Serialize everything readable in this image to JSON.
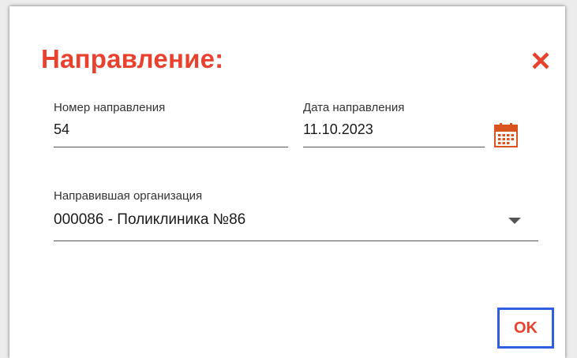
{
  "dialog": {
    "title": "Направление:",
    "close_icon": "close-x-icon",
    "ok_label": "OK"
  },
  "fields": {
    "referral_number": {
      "label": "Номер направления",
      "value": "54"
    },
    "referral_date": {
      "label": "Дата направления",
      "value": "11.10.2023",
      "icon": "calendar-icon"
    },
    "organization": {
      "label": "Направившая организация",
      "value": "000086 - Поликлиника №86",
      "icon": "dropdown-arrow-icon"
    }
  },
  "colors": {
    "accent_red": "#e8412d",
    "focus_blue": "#2f5fe0",
    "calendar_orange": "#d9541e",
    "underline": "#555555"
  }
}
